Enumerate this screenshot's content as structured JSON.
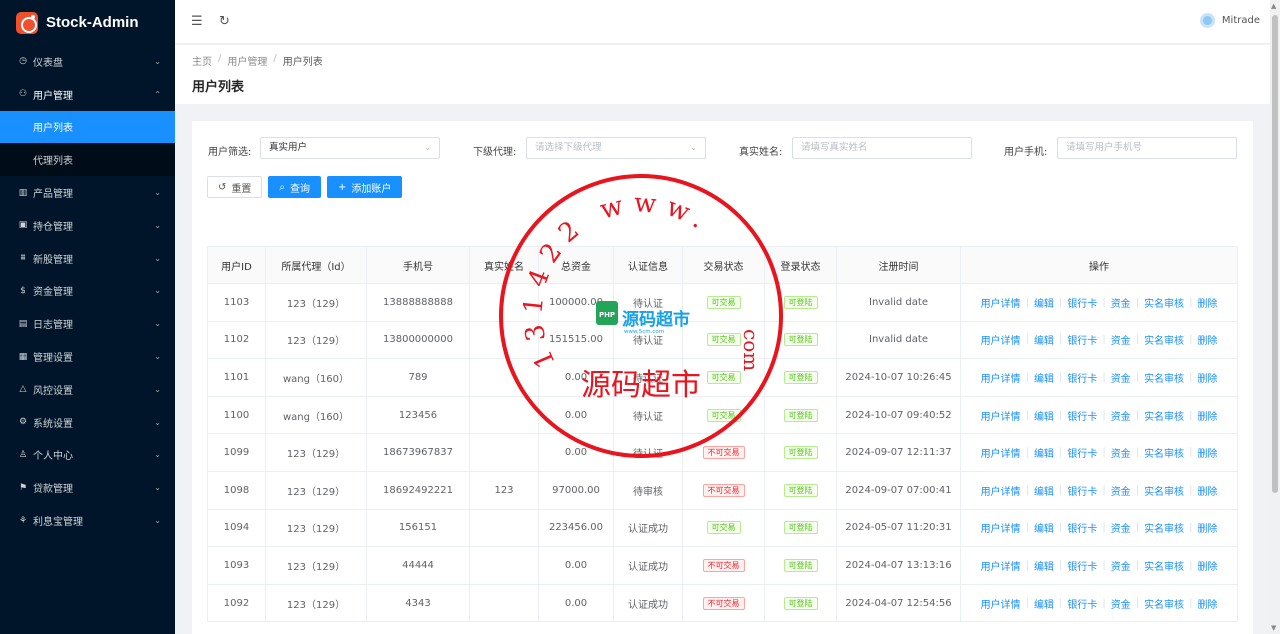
{
  "app": {
    "title": "Stock-Admin"
  },
  "sidebar": {
    "items": [
      {
        "label": "仪表盘",
        "icon": "dashboard-icon",
        "glyph": "◷"
      },
      {
        "label": "用户管理",
        "icon": "user-manage-icon",
        "glyph": "⚇",
        "open": true,
        "children": [
          {
            "label": "用户列表",
            "active": true
          },
          {
            "label": "代理列表"
          }
        ]
      },
      {
        "label": "产品管理",
        "icon": "chart-icon",
        "glyph": "▥"
      },
      {
        "label": "持仓管理",
        "icon": "position-icon",
        "glyph": "▣"
      },
      {
        "label": "新股管理",
        "icon": "ipo-icon",
        "glyph": "⩩"
      },
      {
        "label": "资金管理",
        "icon": "money-icon",
        "glyph": "$"
      },
      {
        "label": "日志管理",
        "icon": "log-icon",
        "glyph": "▤"
      },
      {
        "label": "管理设置",
        "icon": "admin-settings-icon",
        "glyph": "▦"
      },
      {
        "label": "风控设置",
        "icon": "risk-icon",
        "glyph": "△"
      },
      {
        "label": "系统设置",
        "icon": "gear-icon",
        "glyph": "⚙"
      },
      {
        "label": "个人中心",
        "icon": "person-icon",
        "glyph": "♙"
      },
      {
        "label": "贷款管理",
        "icon": "loan-icon",
        "glyph": "⚑"
      },
      {
        "label": "利息宝管理",
        "icon": "interest-icon",
        "glyph": "⚘"
      }
    ]
  },
  "header": {
    "user_name": "Mitrade"
  },
  "breadcrumb": {
    "home": "主页",
    "parent": "用户管理",
    "current": "用户列表"
  },
  "page": {
    "title": "用户列表"
  },
  "filters": {
    "user_filter": {
      "label": "用户筛选:",
      "value": "真实用户"
    },
    "agent": {
      "label": "下级代理:",
      "placeholder": "请选择下级代理"
    },
    "real_name": {
      "label": "真实姓名:",
      "placeholder": "请填写真实姓名"
    },
    "phone": {
      "label": "用户手机:",
      "placeholder": "请填写用户手机号"
    }
  },
  "buttons": {
    "reset": "重置",
    "query": "查询",
    "add": "添加账户"
  },
  "table": {
    "columns": [
      "用户ID",
      "所属代理（Id）",
      "手机号",
      "真实姓名",
      "总资金",
      "认证信息",
      "交易状态",
      "登录状态",
      "注册时间",
      "操作"
    ],
    "rows": [
      [
        "1103",
        "123（129）",
        "13888888888",
        "",
        "100000.00",
        "待认证",
        "可交易",
        "可登陆",
        "Invalid date"
      ],
      [
        "1102",
        "123（129）",
        "13800000000",
        "",
        "151515.00",
        "待认证",
        "可交易",
        "可登陆",
        "Invalid date"
      ],
      [
        "1101",
        "wang（160）",
        "789",
        "",
        "0.00",
        "待认证",
        "可交易",
        "可登陆",
        "2024-10-07 10:26:45"
      ],
      [
        "1100",
        "wang（160）",
        "123456",
        "",
        "0.00",
        "待认证",
        "可交易",
        "可登陆",
        "2024-10-07 09:40:52"
      ],
      [
        "1099",
        "123（129）",
        "18673967837",
        "",
        "0.00",
        "待认证",
        "不可交易",
        "可登陆",
        "2024-09-07 12:11:37"
      ],
      [
        "1098",
        "123（129）",
        "18692492221",
        "123",
        "97000.00",
        "待审核",
        "不可交易",
        "可登陆",
        "2024-09-07 07:00:41"
      ],
      [
        "1094",
        "123（129）",
        "156151",
        "",
        "223456.00",
        "认证成功",
        "可交易",
        "可登陆",
        "2024-05-07 11:20:31"
      ],
      [
        "1093",
        "123（129）",
        "44444",
        "",
        "0.00",
        "认证成功",
        "不可交易",
        "可登陆",
        "2024-04-07 13:13:16"
      ],
      [
        "1092",
        "123（129）",
        "4343",
        "",
        "0.00",
        "认证成功",
        "不可交易",
        "可登陆",
        "2024-04-07 12:54:56"
      ]
    ],
    "actions": [
      "用户详情",
      "编辑",
      "银行卡",
      "资金",
      "实名审核",
      "删除"
    ]
  },
  "watermark": {
    "ring_text": "131422 www.",
    "suffix": "com",
    "center_text": "源码超市",
    "badge": "PHP",
    "badge_sub": "www.5cm.com",
    "color": "#e8141e"
  }
}
